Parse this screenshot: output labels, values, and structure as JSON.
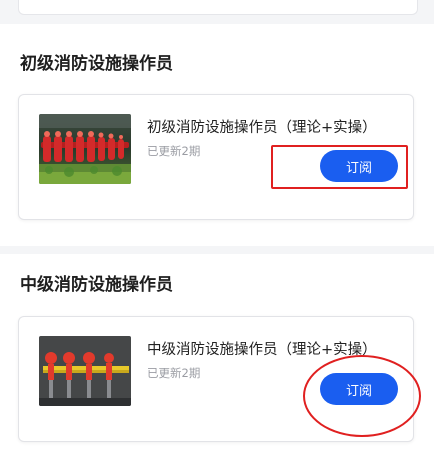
{
  "colors": {
    "accent": "#1a5ef0",
    "annotation": "#e02020",
    "page_bg": "#f4f5f7"
  },
  "courses": [
    {
      "section_title": "初级消防设施操作员",
      "card_title": "初级消防设施操作员（理论+实操）",
      "meta": "已更新2期",
      "button_label": "订阅",
      "thumbnail": "row-of-red-fire-hydrant-valves-image"
    },
    {
      "section_title": "中级消防设施操作员",
      "card_title": "中级消防设施操作员（理论+实操）",
      "meta": "已更新2期",
      "button_label": "订阅",
      "thumbnail": "red-fire-valves-on-grey-wall-image"
    }
  ]
}
